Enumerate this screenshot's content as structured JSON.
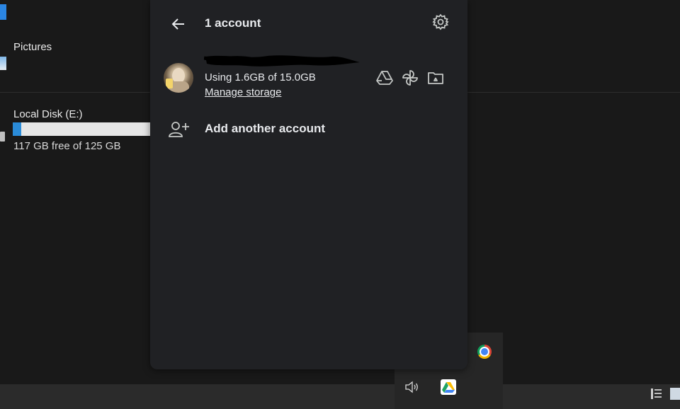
{
  "explorer": {
    "pictures_label": "Pictures",
    "disk_label": "Local Disk (E:)",
    "disk_free_text": "117 GB free of 125 GB",
    "disk_used_fraction": 0.064
  },
  "popup": {
    "header_title": "1 account",
    "storage_usage": "Using 1.6GB of 15.0GB",
    "manage_storage_label": "Manage storage",
    "add_account_label": "Add another account"
  },
  "colors": {
    "popup_bg": "#202124",
    "explorer_bg": "#191919",
    "disk_bar_fill": "#2a8bd8",
    "taskbar_bg": "#2b2b2b"
  },
  "icons": [
    "back-arrow-icon",
    "settings-gear-icon",
    "google-drive-icon",
    "pinwheel-photos-icon",
    "folder-icon",
    "add-person-icon",
    "chrome-icon",
    "volume-icon",
    "google-drive-tray-icon"
  ]
}
